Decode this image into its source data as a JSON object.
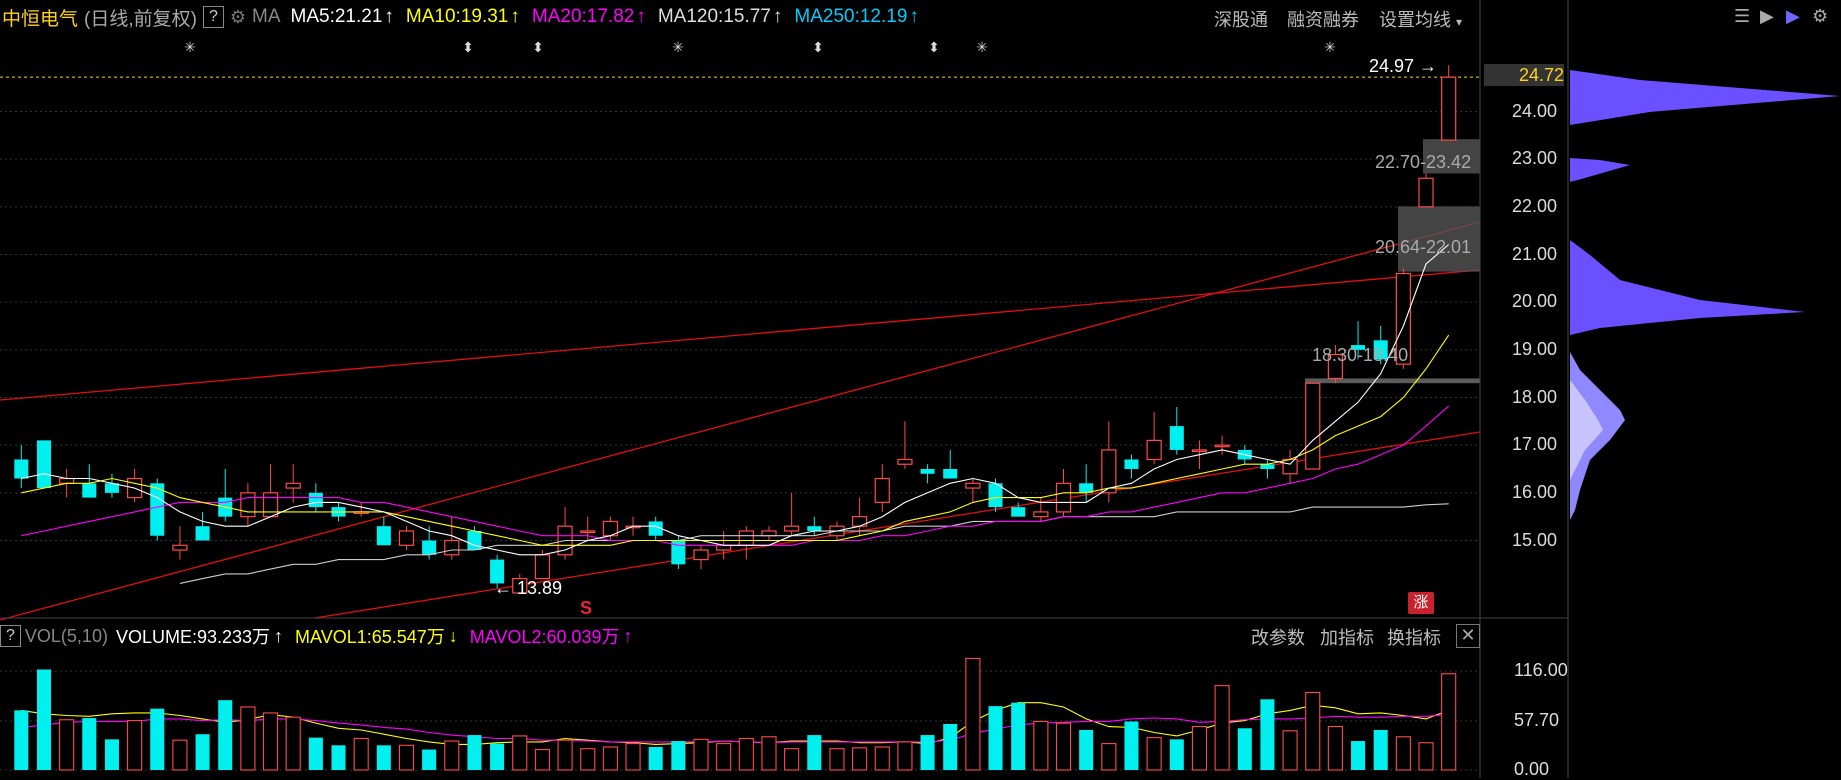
{
  "header": {
    "stock_name": "中恒电气",
    "mode": "(日线,前复权)",
    "help_label": "?",
    "ma_label": "MA",
    "ma5": "MA5:21.21",
    "ma10": "MA10:19.31",
    "ma20": "MA20:17.82",
    "ma120": "MA120:15.77",
    "ma250": "MA250:12.19",
    "up_arrow": "↑",
    "menu_shengutong": "深股通",
    "menu_rongzi": "融资融券",
    "menu_settings": "设置均线",
    "menu_caret": "▾"
  },
  "volume_header": {
    "help_label": "?",
    "vol_label": "VOL(5,10)",
    "volume": "VOLUME:93.233万",
    "mavol1": "MAVOL1:65.547万",
    "mavol2": "MAVOL2:60.039万",
    "up_arrow": "↑",
    "down_arrow": "↓",
    "menu_params": "改参数",
    "menu_add": "加指标",
    "menu_switch": "换指标",
    "close": "✕"
  },
  "right_axis": {
    "current_price": "24.72",
    "price_ticks": [
      "24.00",
      "23.00",
      "22.00",
      "21.00",
      "20.00",
      "19.00",
      "18.00",
      "17.00",
      "16.00",
      "15.00"
    ],
    "volume_ticks": [
      "116.00",
      "57.70",
      "0.00"
    ]
  },
  "annotations": {
    "high": "24.97",
    "low": "13.89",
    "gap1": "22.70-23.42",
    "gap2": "20.64-22.01",
    "gap3": "18.30-18.40",
    "zhang": "涨",
    "s_mark": "S"
  },
  "colors": {
    "up": "#ff4a4a",
    "down": "#00f0f0",
    "ma5": "#ffffff",
    "ma10": "#ffff00",
    "ma20": "#ff00ff",
    "ma120": "#cccccc",
    "ma250": "#00ccff",
    "trend": "#e01010"
  },
  "chart_data": {
    "type": "candlestick",
    "price_range": [
      13.5,
      25.5
    ],
    "candles": [
      {
        "o": 16.7,
        "h": 17.0,
        "l": 16.1,
        "c": 16.3
      },
      {
        "o": 17.1,
        "h": 17.1,
        "l": 16.1,
        "c": 16.1
      },
      {
        "o": 16.2,
        "h": 16.5,
        "l": 15.9,
        "c": 16.3
      },
      {
        "o": 16.2,
        "h": 16.6,
        "l": 15.9,
        "c": 15.9
      },
      {
        "o": 16.2,
        "h": 16.4,
        "l": 15.9,
        "c": 16.0
      },
      {
        "o": 15.9,
        "h": 16.5,
        "l": 15.8,
        "c": 16.3
      },
      {
        "o": 16.2,
        "h": 16.3,
        "l": 15.0,
        "c": 15.1
      },
      {
        "o": 14.8,
        "h": 15.3,
        "l": 14.6,
        "c": 14.9
      },
      {
        "o": 15.3,
        "h": 15.6,
        "l": 15.1,
        "c": 15.0
      },
      {
        "o": 15.9,
        "h": 16.5,
        "l": 15.4,
        "c": 15.5
      },
      {
        "o": 15.5,
        "h": 16.2,
        "l": 15.3,
        "c": 16.0
      },
      {
        "o": 15.5,
        "h": 16.6,
        "l": 15.5,
        "c": 16.0
      },
      {
        "o": 16.1,
        "h": 16.6,
        "l": 15.8,
        "c": 16.2
      },
      {
        "o": 16.0,
        "h": 16.2,
        "l": 15.6,
        "c": 15.7
      },
      {
        "o": 15.7,
        "h": 15.8,
        "l": 15.4,
        "c": 15.5
      },
      {
        "o": 15.6,
        "h": 15.8,
        "l": 15.5,
        "c": 15.6
      },
      {
        "o": 15.3,
        "h": 15.5,
        "l": 14.9,
        "c": 14.9
      },
      {
        "o": 14.9,
        "h": 15.3,
        "l": 14.8,
        "c": 15.2
      },
      {
        "o": 15.0,
        "h": 15.3,
        "l": 14.6,
        "c": 14.7
      },
      {
        "o": 14.7,
        "h": 15.5,
        "l": 14.6,
        "c": 15.0
      },
      {
        "o": 15.2,
        "h": 15.3,
        "l": 14.8,
        "c": 14.8
      },
      {
        "o": 14.6,
        "h": 14.7,
        "l": 14.0,
        "c": 14.1
      },
      {
        "o": 13.9,
        "h": 14.3,
        "l": 13.9,
        "c": 14.2
      },
      {
        "o": 14.2,
        "h": 14.8,
        "l": 14.2,
        "c": 14.7
      },
      {
        "o": 14.7,
        "h": 15.7,
        "l": 14.6,
        "c": 15.3
      },
      {
        "o": 15.2,
        "h": 15.5,
        "l": 15.0,
        "c": 15.2
      },
      {
        "o": 15.1,
        "h": 15.5,
        "l": 15.0,
        "c": 15.4
      },
      {
        "o": 15.3,
        "h": 15.5,
        "l": 15.1,
        "c": 15.3
      },
      {
        "o": 15.4,
        "h": 15.5,
        "l": 15.0,
        "c": 15.1
      },
      {
        "o": 15.0,
        "h": 15.1,
        "l": 14.4,
        "c": 14.5
      },
      {
        "o": 14.6,
        "h": 14.9,
        "l": 14.4,
        "c": 14.8
      },
      {
        "o": 14.8,
        "h": 15.2,
        "l": 14.6,
        "c": 14.9
      },
      {
        "o": 14.9,
        "h": 15.3,
        "l": 14.6,
        "c": 15.2
      },
      {
        "o": 15.1,
        "h": 15.3,
        "l": 15.0,
        "c": 15.2
      },
      {
        "o": 15.2,
        "h": 16.0,
        "l": 15.1,
        "c": 15.3
      },
      {
        "o": 15.3,
        "h": 15.5,
        "l": 15.1,
        "c": 15.2
      },
      {
        "o": 15.1,
        "h": 15.4,
        "l": 15.0,
        "c": 15.3
      },
      {
        "o": 15.3,
        "h": 15.9,
        "l": 15.1,
        "c": 15.5
      },
      {
        "o": 15.8,
        "h": 16.6,
        "l": 15.6,
        "c": 16.3
      },
      {
        "o": 16.6,
        "h": 17.5,
        "l": 16.5,
        "c": 16.7
      },
      {
        "o": 16.5,
        "h": 16.6,
        "l": 16.2,
        "c": 16.4
      },
      {
        "o": 16.5,
        "h": 16.9,
        "l": 16.3,
        "c": 16.3
      },
      {
        "o": 16.1,
        "h": 16.3,
        "l": 15.8,
        "c": 16.2
      },
      {
        "o": 16.2,
        "h": 16.3,
        "l": 15.6,
        "c": 15.7
      },
      {
        "o": 15.7,
        "h": 15.8,
        "l": 15.5,
        "c": 15.5
      },
      {
        "o": 15.5,
        "h": 15.9,
        "l": 15.4,
        "c": 15.6
      },
      {
        "o": 15.6,
        "h": 16.5,
        "l": 15.5,
        "c": 16.2
      },
      {
        "o": 16.2,
        "h": 16.6,
        "l": 15.8,
        "c": 16.0
      },
      {
        "o": 16.0,
        "h": 17.5,
        "l": 15.8,
        "c": 16.9
      },
      {
        "o": 16.7,
        "h": 16.8,
        "l": 16.3,
        "c": 16.5
      },
      {
        "o": 16.7,
        "h": 17.7,
        "l": 16.6,
        "c": 17.1
      },
      {
        "o": 17.4,
        "h": 17.8,
        "l": 16.8,
        "c": 16.9
      },
      {
        "o": 16.9,
        "h": 17.1,
        "l": 16.5,
        "c": 16.9
      },
      {
        "o": 17.0,
        "h": 17.2,
        "l": 16.8,
        "c": 17.0
      },
      {
        "o": 16.9,
        "h": 17.0,
        "l": 16.6,
        "c": 16.7
      },
      {
        "o": 16.6,
        "h": 16.7,
        "l": 16.3,
        "c": 16.5
      },
      {
        "o": 16.4,
        "h": 16.9,
        "l": 16.2,
        "c": 16.7
      },
      {
        "o": 16.5,
        "h": 18.3,
        "l": 16.5,
        "c": 18.3
      },
      {
        "o": 18.4,
        "h": 19.1,
        "l": 18.3,
        "c": 18.9
      },
      {
        "o": 19.1,
        "h": 19.6,
        "l": 18.8,
        "c": 19.0
      },
      {
        "o": 19.2,
        "h": 19.5,
        "l": 18.7,
        "c": 18.8
      },
      {
        "o": 18.7,
        "h": 20.7,
        "l": 18.6,
        "c": 20.6
      },
      {
        "o": 22.0,
        "h": 22.7,
        "l": 22.0,
        "c": 22.6
      },
      {
        "o": 23.4,
        "h": 24.97,
        "l": 23.4,
        "c": 24.72
      }
    ],
    "volumes": [
      70,
      118,
      59,
      61,
      36,
      58,
      72,
      35,
      42,
      82,
      74,
      67,
      62,
      38,
      29,
      37,
      29,
      29,
      24,
      34,
      41,
      31,
      40,
      24,
      35,
      25,
      27,
      31,
      27,
      34,
      36,
      31,
      37,
      39,
      25,
      41,
      25,
      26,
      27,
      33,
      41,
      54,
      131,
      75,
      79,
      57,
      55,
      47,
      31,
      57,
      38,
      36,
      51,
      99,
      49,
      83,
      46,
      91,
      51,
      34,
      47,
      39,
      32,
      113
    ],
    "mavol1": [
      70,
      66,
      64,
      63,
      66,
      67,
      67,
      64,
      60,
      56,
      59,
      65,
      62,
      55,
      49,
      47,
      42,
      37,
      33,
      30,
      30,
      32,
      33,
      33,
      37,
      35,
      33,
      32,
      30,
      31,
      32,
      34,
      33,
      32,
      34,
      34,
      34,
      32,
      32,
      33,
      31,
      38,
      57,
      70,
      79,
      79,
      74,
      60,
      51,
      50,
      44,
      40,
      47,
      55,
      58,
      66,
      70,
      76,
      73,
      66,
      67,
      64,
      60,
      70
    ],
    "mavol2": [
      50,
      53,
      56,
      57,
      57,
      57,
      60,
      60,
      58,
      59,
      58,
      60,
      60,
      58,
      55,
      53,
      50,
      48,
      44,
      41,
      39,
      37,
      37,
      35,
      35,
      34,
      33,
      33,
      33,
      33,
      33,
      34,
      33,
      32,
      33,
      33,
      33,
      33,
      33,
      33,
      33,
      35,
      43,
      48,
      53,
      55,
      56,
      57,
      57,
      60,
      61,
      60,
      56,
      57,
      59,
      60,
      60,
      61,
      63,
      62,
      62,
      63,
      63,
      65
    ],
    "ma5_line": [
      16.3,
      16.4,
      16.3,
      16.3,
      16.2,
      16.1,
      15.9,
      15.6,
      15.4,
      15.3,
      15.3,
      15.5,
      15.7,
      15.8,
      15.8,
      15.7,
      15.6,
      15.4,
      15.2,
      15.1,
      14.9,
      14.8,
      14.7,
      14.7,
      14.8,
      15.0,
      15.1,
      15.3,
      15.3,
      15.1,
      15.0,
      14.9,
      14.9,
      14.9,
      15.1,
      15.2,
      15.2,
      15.3,
      15.5,
      15.8,
      16.0,
      16.2,
      16.3,
      16.2,
      15.9,
      15.8,
      15.8,
      15.8,
      16.1,
      16.2,
      16.5,
      16.7,
      16.8,
      16.9,
      16.8,
      16.7,
      16.6,
      17.1,
      17.5,
      17.9,
      18.5,
      19.5,
      20.8,
      21.21
    ],
    "ma10_line": [
      16.0,
      16.1,
      16.2,
      16.2,
      16.3,
      16.2,
      16.1,
      15.9,
      15.8,
      15.7,
      15.6,
      15.6,
      15.6,
      15.6,
      15.6,
      15.6,
      15.6,
      15.5,
      15.4,
      15.3,
      15.2,
      15.1,
      15.0,
      14.9,
      14.9,
      14.9,
      14.9,
      15.0,
      15.0,
      15.0,
      15.0,
      15.0,
      15.0,
      15.0,
      15.0,
      15.0,
      15.0,
      15.1,
      15.2,
      15.4,
      15.5,
      15.6,
      15.8,
      15.9,
      15.9,
      15.9,
      16.0,
      16.0,
      16.1,
      16.1,
      16.2,
      16.3,
      16.4,
      16.5,
      16.6,
      16.6,
      16.7,
      16.9,
      17.2,
      17.4,
      17.6,
      18.0,
      18.6,
      19.31
    ],
    "ma20_line": [
      15.1,
      15.2,
      15.3,
      15.4,
      15.5,
      15.6,
      15.7,
      15.8,
      15.8,
      15.8,
      15.9,
      15.9,
      15.9,
      15.9,
      15.9,
      15.8,
      15.8,
      15.7,
      15.6,
      15.5,
      15.4,
      15.3,
      15.2,
      15.1,
      15.1,
      15.1,
      15.0,
      15.0,
      15.0,
      14.9,
      14.9,
      14.9,
      14.9,
      14.9,
      14.9,
      15.0,
      15.0,
      15.0,
      15.1,
      15.1,
      15.2,
      15.3,
      15.3,
      15.4,
      15.4,
      15.4,
      15.5,
      15.5,
      15.6,
      15.6,
      15.7,
      15.8,
      15.9,
      16.0,
      16.0,
      16.1,
      16.2,
      16.3,
      16.5,
      16.6,
      16.8,
      17.0,
      17.4,
      17.82
    ],
    "ma120_line": [
      null,
      null,
      null,
      null,
      null,
      null,
      null,
      14.1,
      14.2,
      14.3,
      14.3,
      14.4,
      14.5,
      14.5,
      14.6,
      14.6,
      14.6,
      14.7,
      14.7,
      14.8,
      14.8,
      14.9,
      14.9,
      14.9,
      15.0,
      15.0,
      15.0,
      15.0,
      15.0,
      15.0,
      15.1,
      15.1,
      15.1,
      15.1,
      15.1,
      15.1,
      15.2,
      15.2,
      15.2,
      15.3,
      15.3,
      15.3,
      15.4,
      15.4,
      15.4,
      15.4,
      15.5,
      15.5,
      15.5,
      15.5,
      15.5,
      15.6,
      15.6,
      15.6,
      15.6,
      15.6,
      15.6,
      15.7,
      15.7,
      15.7,
      15.7,
      15.7,
      15.75,
      15.77
    ]
  }
}
